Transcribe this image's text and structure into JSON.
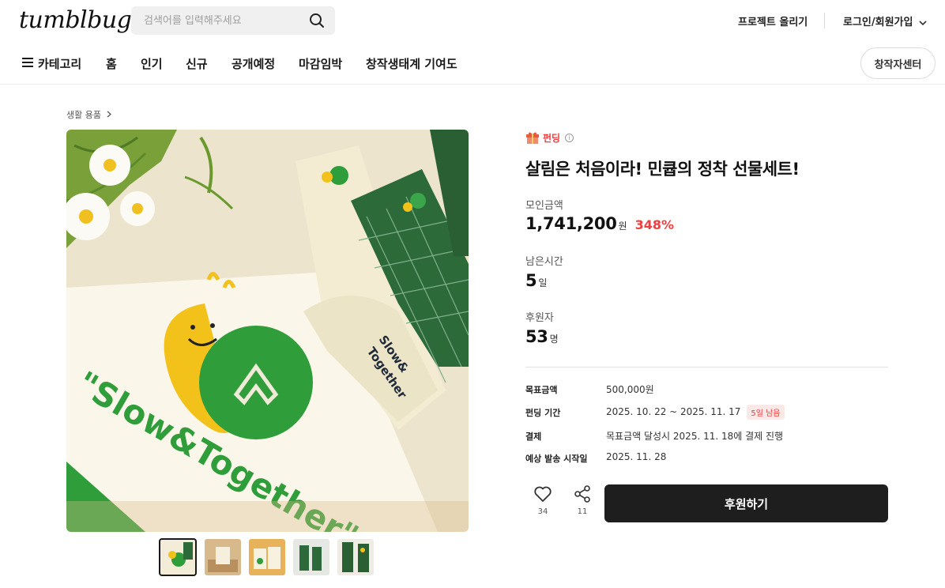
{
  "header": {
    "logo": "tumblbug",
    "search_placeholder": "검색어를 입력해주세요",
    "project_upload": "프로젝트 올리기",
    "login": "로그인/회원가입"
  },
  "nav": {
    "category": "카테고리",
    "items": [
      "홈",
      "인기",
      "신규",
      "공개예정",
      "마감임박",
      "창작생태계 기여도"
    ],
    "creator_center": "창작자센터"
  },
  "breadcrumb": "생활 용품",
  "image": {
    "text_towel": "\"Slow&Together\"",
    "text_sock_line1": "Slow&",
    "text_sock_line2": "Together",
    "thumbnail_count": 5
  },
  "project": {
    "badge": "펀딩",
    "title": "살림은 처음이라! 민큡의 정착 선물세트!",
    "raised_label": "모인금액",
    "raised_value": "1,741,200",
    "raised_unit": "원",
    "raised_percent": "348%",
    "remaining_label": "남은시간",
    "remaining_value": "5",
    "remaining_unit": "일",
    "backers_label": "후원자",
    "backers_value": "53",
    "backers_unit": "명"
  },
  "details": {
    "goal_label": "목표금액",
    "goal_value": "500,000원",
    "period_label": "펀딩 기간",
    "period_value": "2025. 10. 22 ~ 2025. 11. 17",
    "period_tag": "5일 남음",
    "payment_label": "결제",
    "payment_value": "목표금액 달성시 2025. 11. 18에 결제 진행",
    "ship_label": "예상 발송 시작일",
    "ship_value": "2025. 11. 28"
  },
  "actions": {
    "like_count": "34",
    "share_count": "11",
    "support_button": "후원하기"
  },
  "colors": {
    "accent_red": "#f03e3e",
    "button_dark": "#1e1e1e",
    "green": "#2e8b3e"
  }
}
